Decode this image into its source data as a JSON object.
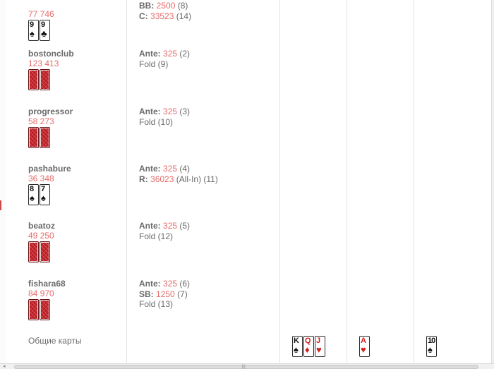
{
  "players": [
    {
      "name": "",
      "stack": "77 746",
      "cards": [
        {
          "rank": "9",
          "suit": "♠",
          "color": "black"
        },
        {
          "rank": "9",
          "suit": "♣",
          "color": "black"
        }
      ],
      "actions": [
        {
          "label": "BB:",
          "amount": "2500",
          "seq": "(8)"
        },
        {
          "label": "C:",
          "amount": "33523",
          "seq": "(14)"
        }
      ]
    },
    {
      "name": "bostonclub",
      "stack": "123 413",
      "cards": [
        {
          "back": true
        },
        {
          "back": true
        }
      ],
      "actions": [
        {
          "label": "Ante:",
          "amount": "325",
          "seq": "(2)"
        },
        {
          "text": "Fold (9)"
        }
      ]
    },
    {
      "name": "progressor",
      "stack": "58 273",
      "cards": [
        {
          "back": true
        },
        {
          "back": true
        }
      ],
      "actions": [
        {
          "label": "Ante:",
          "amount": "325",
          "seq": "(3)"
        },
        {
          "text": "Fold (10)"
        }
      ]
    },
    {
      "name": "pashabure",
      "stack": "36 348",
      "cards": [
        {
          "rank": "8",
          "suit": "♠",
          "color": "black"
        },
        {
          "rank": "7",
          "suit": "♠",
          "color": "black"
        }
      ],
      "actions": [
        {
          "label": "Ante:",
          "amount": "325",
          "seq": "(4)"
        },
        {
          "label": "R:",
          "amount": "36023",
          "seq": "(All-In) (11)"
        }
      ]
    },
    {
      "name": "beatoz",
      "stack": "49 250",
      "cards": [
        {
          "back": true
        },
        {
          "back": true
        }
      ],
      "actions": [
        {
          "label": "Ante:",
          "amount": "325",
          "seq": "(5)"
        },
        {
          "text": "Fold (12)"
        }
      ]
    },
    {
      "name": "fishara68",
      "stack": "84 970",
      "cards": [
        {
          "back": true
        },
        {
          "back": true
        }
      ],
      "actions": [
        {
          "label": "Ante:",
          "amount": "325",
          "seq": "(6)"
        },
        {
          "label": "SB:",
          "amount": "1250",
          "seq": "(7)"
        },
        {
          "text": "Fold (13)"
        }
      ]
    }
  ],
  "board": {
    "label": "Общие карты",
    "flop": [
      {
        "rank": "K",
        "suit": "♠",
        "color": "black"
      },
      {
        "rank": "Q",
        "suit": "♦",
        "color": "red"
      },
      {
        "rank": "J",
        "suit": "♥",
        "color": "red"
      }
    ],
    "turn": [
      {
        "rank": "A",
        "suit": "♥",
        "color": "red"
      }
    ],
    "river": [
      {
        "rank": "10",
        "suit": "♠",
        "color": "black"
      }
    ]
  },
  "colors": {
    "amount": "#e66b6b",
    "text": "#6a6a6a",
    "card_back": "#c8232a",
    "red_suit": "#d21f1f"
  }
}
